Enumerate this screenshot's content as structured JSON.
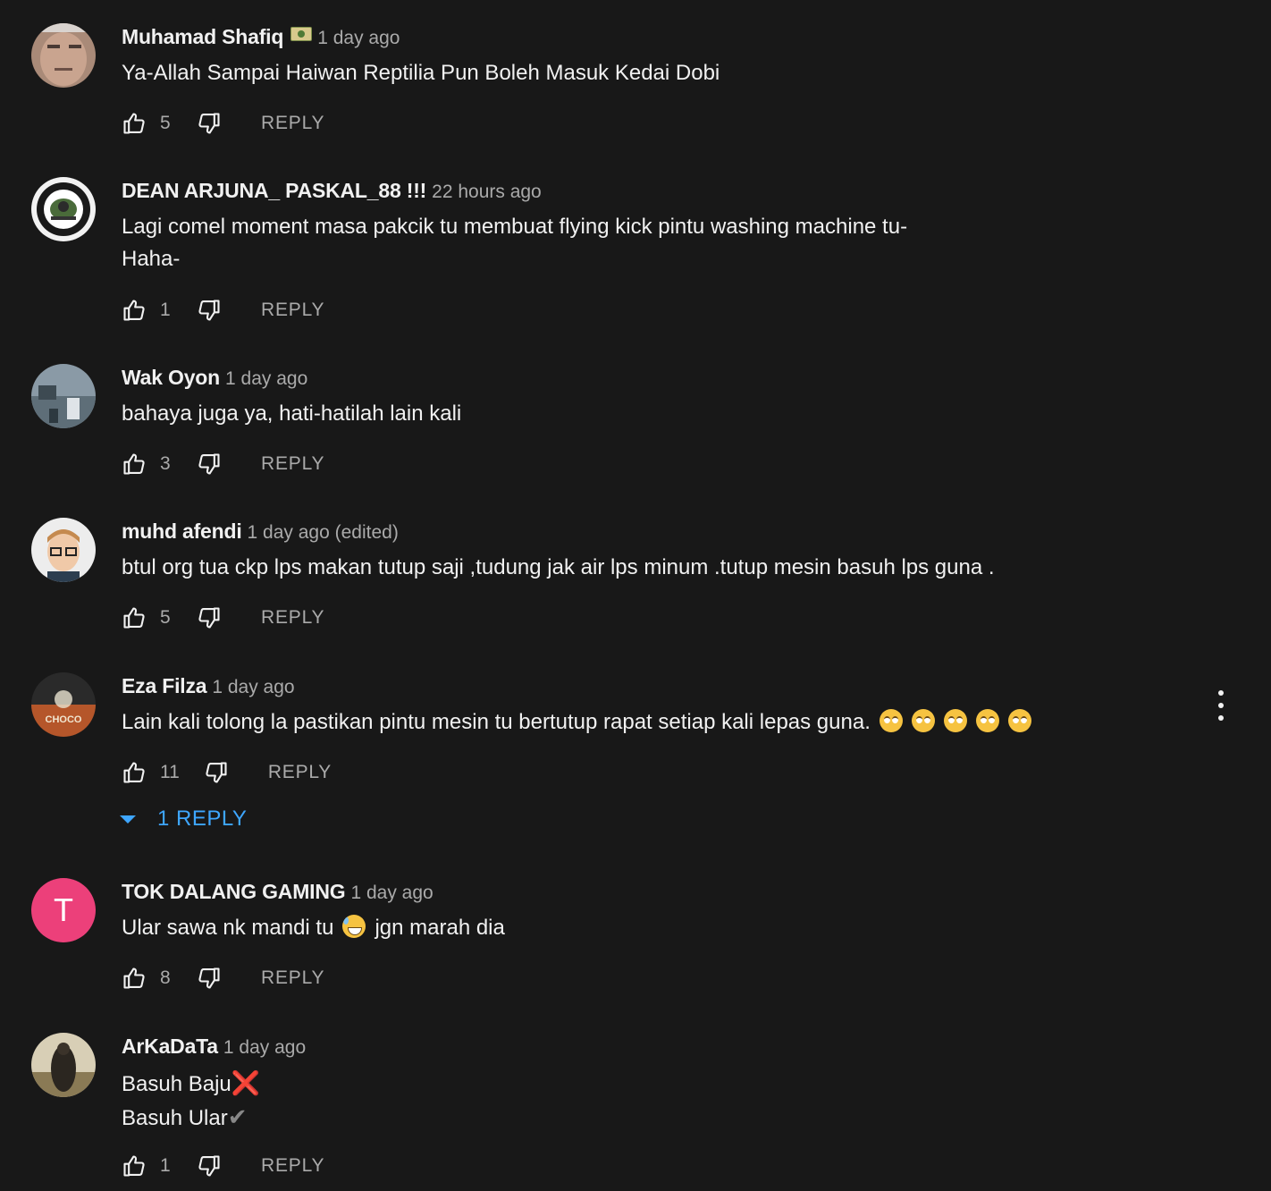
{
  "colors": {
    "background": "#181818",
    "text_primary": "#f1f1f1",
    "text_secondary": "#aaaaaa",
    "link_blue": "#3ea6ff",
    "avatar_pink": "#ec407a"
  },
  "icons": {
    "like": "thumb-up-icon",
    "dislike": "thumb-down-icon",
    "more": "more-vertical-icon",
    "expand": "triangle-down-icon"
  },
  "reply_label": "REPLY",
  "comments": [
    {
      "author": "Muhamad Shafiq",
      "badge": "money-emoji",
      "time": "1 day ago",
      "lines": [
        "Ya-Allah Sampai Haiwan Reptilia Pun Boleh Masuk Kedai Dobi"
      ],
      "likes": "5"
    },
    {
      "author": "DEAN ARJUNA_ PASKAL_88 !!!",
      "time": "22 hours ago",
      "lines": [
        "Lagi comel moment masa pakcik tu membuat flying kick pintu washing machine tu-",
        "Haha-"
      ],
      "likes": "1"
    },
    {
      "author": "Wak Oyon",
      "time": "1 day ago",
      "lines": [
        "bahaya juga ya, hati-hatilah lain kali"
      ],
      "likes": "3"
    },
    {
      "author": "muhd afendi",
      "time": "1 day ago (edited)",
      "lines": [
        "btul org tua ckp lps makan tutup saji ,tudung jak air lps minum .tutup mesin basuh lps guna ."
      ],
      "likes": "5"
    },
    {
      "author": "Eza Filza",
      "time": "1 day ago",
      "lines": [
        "Lain kali tolong la pastikan pintu mesin tu bertutup rapat setiap kali lepas guna."
      ],
      "emoji": "face-with-rolling-eyes",
      "emoji_count": 5,
      "likes": "11",
      "replies_label": "1 REPLY",
      "avatar_text": "CHOCO"
    },
    {
      "author": "TOK DALANG GAMING",
      "time": "1 day ago",
      "text_before": "Ular sawa nk mandi tu",
      "emoji": "grinning-face-with-sweat",
      "text_after": "jgn marah dia",
      "likes": "8",
      "avatar_letter": "T"
    },
    {
      "author": "ArKaDaTa",
      "time": "1 day ago",
      "line1": "Basuh Baju",
      "line1_mark": "❌",
      "line2": "Basuh Ular",
      "line2_mark": "✔",
      "likes": "1"
    }
  ]
}
